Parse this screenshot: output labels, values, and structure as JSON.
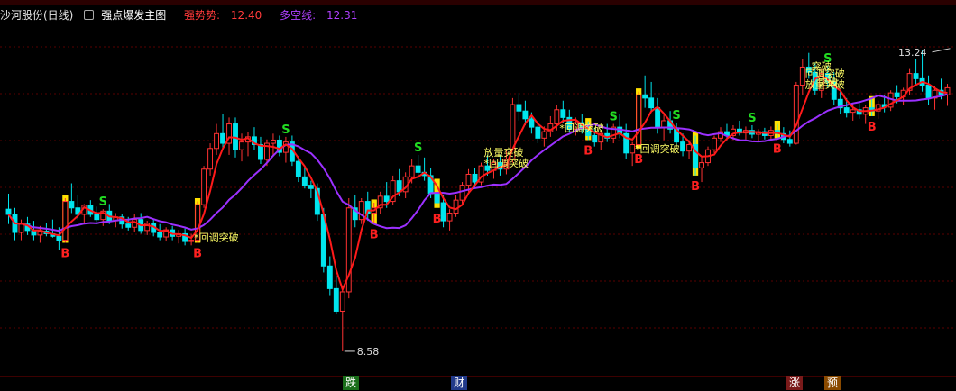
{
  "header": {
    "stock": "沙河股份(日线)",
    "indicator": "强点爆发主图",
    "line1_label": "强势势:",
    "line1_value": "12.40",
    "line2_label": "多空线:",
    "line2_value": "12.31"
  },
  "colors": {
    "up": "#ff3232",
    "down": "#00e5ee",
    "strong": "#ff1a1a",
    "dk": "#9b30ff",
    "bar": "#ffe000",
    "buy": "#ff2020",
    "sell": "#22dd22",
    "label": "#ffff66"
  },
  "chart_data": {
    "type": "candlestick",
    "annotations": {
      "max": "13.24",
      "min": "8.58",
      "buy": "B",
      "sell": "S",
      "pullback": "回调突破",
      "pullback_star": "*回调突破",
      "volume_break": "放量突破",
      "break": "突破"
    },
    "candles": [
      [
        10.78,
        11.02,
        10.55,
        10.7
      ],
      [
        10.7,
        10.8,
        10.3,
        10.42
      ],
      [
        10.42,
        10.62,
        10.3,
        10.55
      ],
      [
        10.55,
        10.66,
        10.38,
        10.45
      ],
      [
        10.45,
        10.6,
        10.3,
        10.38
      ],
      [
        10.38,
        10.52,
        10.26,
        10.44
      ],
      [
        10.44,
        10.56,
        10.36,
        10.4
      ],
      [
        10.4,
        10.62,
        10.34,
        10.36
      ],
      [
        10.36,
        10.5,
        10.15,
        10.3
      ],
      [
        10.3,
        10.95,
        10.26,
        10.9
      ],
      [
        10.9,
        11.18,
        10.72,
        10.8
      ],
      [
        10.8,
        11.0,
        10.62,
        10.7
      ],
      [
        10.7,
        10.86,
        10.56,
        10.84
      ],
      [
        10.84,
        10.92,
        10.66,
        10.7
      ],
      [
        10.7,
        10.82,
        10.56,
        10.62
      ],
      [
        10.62,
        10.78,
        10.52,
        10.75
      ],
      [
        10.75,
        10.86,
        10.55,
        10.6
      ],
      [
        10.6,
        10.72,
        10.5,
        10.66
      ],
      [
        10.66,
        10.7,
        10.48,
        10.55
      ],
      [
        10.55,
        10.66,
        10.45,
        10.5
      ],
      [
        10.5,
        10.7,
        10.42,
        10.62
      ],
      [
        10.62,
        10.72,
        10.4,
        10.45
      ],
      [
        10.45,
        10.6,
        10.38,
        10.56
      ],
      [
        10.56,
        10.62,
        10.36,
        10.42
      ],
      [
        10.42,
        10.55,
        10.3,
        10.35
      ],
      [
        10.35,
        10.5,
        10.28,
        10.46
      ],
      [
        10.46,
        10.52,
        10.3,
        10.36
      ],
      [
        10.36,
        10.46,
        10.25,
        10.4
      ],
      [
        10.4,
        10.48,
        10.22,
        10.28
      ],
      [
        10.28,
        10.4,
        10.22,
        10.3
      ],
      [
        10.3,
        10.9,
        10.26,
        10.85
      ],
      [
        10.85,
        11.45,
        10.8,
        11.4
      ],
      [
        11.4,
        11.8,
        11.3,
        11.72
      ],
      [
        11.72,
        12.1,
        11.62,
        11.95
      ],
      [
        11.95,
        12.25,
        11.7,
        11.8
      ],
      [
        11.8,
        12.2,
        11.62,
        12.1
      ],
      [
        12.1,
        12.2,
        11.58,
        11.7
      ],
      [
        11.7,
        11.95,
        11.52,
        11.82
      ],
      [
        11.82,
        11.98,
        11.6,
        11.9
      ],
      [
        11.9,
        12.05,
        11.7,
        11.78
      ],
      [
        11.78,
        11.9,
        11.48,
        11.55
      ],
      [
        11.55,
        11.86,
        11.45,
        11.8
      ],
      [
        11.8,
        11.95,
        11.62,
        11.85
      ],
      [
        11.85,
        11.92,
        11.6,
        11.66
      ],
      [
        11.66,
        11.9,
        11.5,
        11.82
      ],
      [
        11.82,
        11.92,
        11.45,
        11.52
      ],
      [
        11.52,
        11.6,
        11.2,
        11.28
      ],
      [
        11.28,
        11.45,
        11.1,
        11.15
      ],
      [
        11.15,
        11.22,
        10.95,
        11.1
      ],
      [
        11.1,
        11.18,
        10.6,
        10.7
      ],
      [
        10.7,
        10.8,
        9.8,
        9.9
      ],
      [
        9.9,
        10.05,
        9.45,
        9.55
      ],
      [
        9.55,
        9.75,
        9.15,
        9.2
      ],
      [
        9.2,
        9.6,
        8.58,
        9.5
      ],
      [
        9.5,
        10.95,
        9.4,
        10.8
      ],
      [
        10.8,
        11.0,
        10.5,
        10.62
      ],
      [
        10.62,
        10.95,
        10.55,
        10.9
      ],
      [
        10.9,
        11.05,
        10.6,
        10.72
      ],
      [
        10.72,
        10.88,
        10.55,
        10.8
      ],
      [
        10.8,
        11.05,
        10.7,
        10.98
      ],
      [
        10.98,
        11.2,
        10.8,
        10.9
      ],
      [
        10.9,
        11.3,
        10.84,
        11.22
      ],
      [
        11.22,
        11.4,
        10.98,
        11.05
      ],
      [
        11.05,
        11.35,
        10.95,
        11.28
      ],
      [
        11.28,
        11.55,
        11.18,
        11.45
      ],
      [
        11.45,
        11.62,
        11.25,
        11.35
      ],
      [
        11.35,
        11.58,
        11.22,
        11.3
      ],
      [
        11.3,
        11.42,
        10.95,
        11.02
      ],
      [
        11.02,
        11.2,
        10.8,
        10.88
      ],
      [
        10.88,
        11.0,
        10.5,
        10.6
      ],
      [
        10.6,
        10.78,
        10.45,
        10.72
      ],
      [
        10.72,
        11.0,
        10.66,
        10.92
      ],
      [
        10.92,
        11.2,
        10.84,
        11.15
      ],
      [
        11.15,
        11.4,
        11.05,
        11.32
      ],
      [
        11.32,
        11.42,
        11.12,
        11.2
      ],
      [
        11.2,
        11.5,
        11.15,
        11.45
      ],
      [
        11.45,
        11.62,
        11.3,
        11.38
      ],
      [
        11.38,
        11.55,
        11.25,
        11.5
      ],
      [
        11.5,
        11.62,
        11.3,
        11.4
      ],
      [
        11.4,
        11.7,
        11.32,
        11.55
      ],
      [
        11.55,
        12.5,
        11.5,
        12.4
      ],
      [
        12.4,
        12.58,
        12.15,
        12.3
      ],
      [
        12.3,
        12.46,
        12.08,
        12.18
      ],
      [
        12.18,
        12.28,
        11.95,
        12.05
      ],
      [
        12.05,
        12.15,
        11.8,
        11.88
      ],
      [
        11.88,
        12.06,
        11.75,
        11.98
      ],
      [
        11.98,
        12.22,
        11.9,
        12.1
      ],
      [
        12.1,
        12.4,
        12.0,
        12.32
      ],
      [
        12.32,
        12.46,
        12.12,
        12.2
      ],
      [
        12.2,
        12.32,
        11.98,
        12.02
      ],
      [
        12.02,
        12.2,
        11.92,
        12.12
      ],
      [
        12.12,
        12.25,
        11.95,
        12.02
      ],
      [
        12.02,
        12.14,
        11.85,
        11.92
      ],
      [
        11.92,
        12.04,
        11.75,
        11.82
      ],
      [
        11.82,
        12.0,
        11.7,
        11.95
      ],
      [
        11.95,
        12.1,
        11.82,
        11.88
      ],
      [
        11.88,
        12.1,
        11.8,
        12.05
      ],
      [
        12.05,
        12.25,
        11.88,
        11.95
      ],
      [
        11.95,
        12.1,
        11.55,
        11.65
      ],
      [
        11.65,
        11.82,
        11.45,
        11.78
      ],
      [
        11.78,
        12.6,
        11.72,
        12.55
      ],
      [
        12.55,
        12.85,
        12.35,
        12.5
      ],
      [
        12.5,
        12.75,
        12.3,
        12.35
      ],
      [
        12.35,
        12.5,
        11.95,
        12.05
      ],
      [
        12.05,
        12.25,
        11.85,
        12.15
      ],
      [
        12.15,
        12.3,
        11.95,
        12.02
      ],
      [
        12.02,
        12.12,
        11.75,
        11.82
      ],
      [
        11.82,
        11.95,
        11.6,
        11.68
      ],
      [
        11.68,
        11.85,
        11.55,
        11.78
      ],
      [
        11.78,
        11.92,
        11.3,
        11.42
      ],
      [
        11.42,
        11.6,
        11.2,
        11.5
      ],
      [
        11.5,
        11.75,
        11.45,
        11.7
      ],
      [
        11.7,
        11.92,
        11.65,
        11.88
      ],
      [
        11.88,
        12.05,
        11.82,
        11.98
      ],
      [
        11.98,
        12.1,
        11.85,
        11.92
      ],
      [
        11.92,
        12.08,
        11.85,
        12.02
      ],
      [
        12.02,
        12.15,
        11.92,
        11.96
      ],
      [
        11.96,
        12.06,
        11.86,
        12.0
      ],
      [
        12.0,
        12.08,
        11.88,
        11.94
      ],
      [
        11.94,
        12.02,
        11.84,
        11.98
      ],
      [
        11.98,
        12.04,
        11.86,
        11.92
      ],
      [
        11.92,
        12.06,
        11.84,
        12.0
      ],
      [
        12.0,
        12.1,
        11.88,
        11.95
      ],
      [
        11.95,
        12.05,
        11.8,
        11.86
      ],
      [
        11.86,
        12.0,
        11.75,
        11.8
      ],
      [
        11.8,
        12.75,
        11.78,
        12.7
      ],
      [
        12.7,
        13.1,
        12.55,
        12.98
      ],
      [
        12.98,
        13.2,
        12.8,
        12.9
      ],
      [
        12.9,
        13.05,
        12.55,
        12.62
      ],
      [
        12.62,
        12.95,
        12.5,
        12.88
      ],
      [
        12.88,
        13.0,
        12.66,
        12.75
      ],
      [
        12.75,
        12.9,
        12.4,
        12.48
      ],
      [
        12.48,
        12.6,
        12.25,
        12.35
      ],
      [
        12.35,
        12.5,
        12.2,
        12.28
      ],
      [
        12.28,
        12.42,
        12.15,
        12.32
      ],
      [
        12.32,
        12.45,
        12.18,
        12.25
      ],
      [
        12.25,
        12.4,
        12.1,
        12.35
      ],
      [
        12.35,
        12.48,
        12.22,
        12.3
      ],
      [
        12.3,
        12.46,
        12.18,
        12.4
      ],
      [
        12.4,
        12.55,
        12.28,
        12.36
      ],
      [
        12.36,
        12.62,
        12.3,
        12.58
      ],
      [
        12.58,
        12.7,
        12.42,
        12.52
      ],
      [
        12.52,
        12.66,
        12.4,
        12.62
      ],
      [
        12.62,
        12.95,
        12.55,
        12.88
      ],
      [
        12.88,
        13.1,
        12.7,
        12.8
      ],
      [
        12.8,
        13.24,
        12.6,
        12.7
      ],
      [
        12.7,
        12.85,
        12.4,
        12.5
      ],
      [
        12.5,
        12.68,
        12.32,
        12.62
      ],
      [
        12.62,
        12.8,
        12.48,
        12.55
      ],
      [
        12.55,
        12.72,
        12.38,
        12.66
      ]
    ],
    "signals": [
      {
        "i": 9,
        "mark": "B"
      },
      {
        "i": 15,
        "mark": "S"
      },
      {
        "i": 30,
        "mark": "B"
      },
      {
        "i": 44,
        "mark": "S"
      },
      {
        "i": 58,
        "mark": "B"
      },
      {
        "i": 65,
        "mark": "S"
      },
      {
        "i": 68,
        "mark": "B"
      },
      {
        "i": 92,
        "mark": "B"
      },
      {
        "i": 96,
        "mark": "S"
      },
      {
        "i": 100,
        "mark": "B"
      },
      {
        "i": 106,
        "mark": "S"
      },
      {
        "i": 109,
        "mark": "B"
      },
      {
        "i": 118,
        "mark": "S"
      },
      {
        "i": 122,
        "mark": "B"
      },
      {
        "i": 130,
        "mark": "S"
      },
      {
        "i": 137,
        "mark": "B"
      }
    ],
    "bottom_markers": [
      "跌",
      "财",
      "涨",
      "预"
    ]
  }
}
